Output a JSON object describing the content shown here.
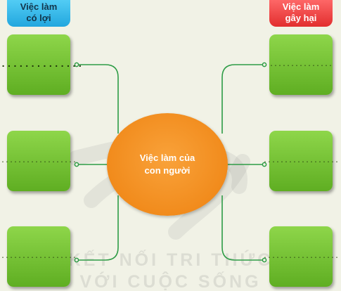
{
  "headers": {
    "left": [
      "Việc làm",
      "có lợi"
    ],
    "right": [
      "Việc làm",
      "gây hại"
    ]
  },
  "center": {
    "lines": [
      "Việc làm của",
      "con người"
    ]
  },
  "boxes": {
    "left": [
      "...............",
      "..................",
      ".................."
    ],
    "right": [
      "...............",
      "..................",
      ".................."
    ]
  },
  "watermark": {
    "line1": "KẾT NỐI TRI THỨC",
    "line2": "VỚI CUỘC SỐNG"
  },
  "colors": {
    "background": "#f1f2e6",
    "box_green": "#6dbd30",
    "center_orange": "#f18b1c",
    "header_blue": "#22a7de",
    "header_red": "#e22e2e",
    "connector": "#2e9c46"
  }
}
